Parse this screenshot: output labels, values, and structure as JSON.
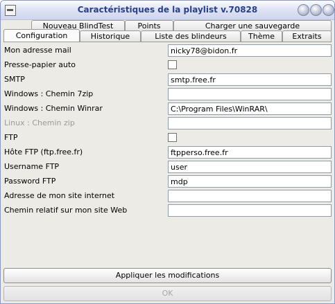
{
  "window": {
    "title": "Caractéristiques de la playlist v.70828"
  },
  "tabs_back": [
    {
      "label": "Nouveau BlindTest"
    },
    {
      "label": "Points"
    },
    {
      "label": "Charger une sauvegarde"
    }
  ],
  "tabs_front": [
    {
      "label": "Configuration",
      "active": true
    },
    {
      "label": "Historique"
    },
    {
      "label": "Liste des blindeurs"
    },
    {
      "label": "Thème"
    },
    {
      "label": "Extraits"
    }
  ],
  "form": {
    "rows": [
      {
        "label": "Mon adresse mail",
        "type": "text",
        "value": "nicky78@bidon.fr"
      },
      {
        "label": "Presse-papier auto",
        "type": "checkbox",
        "checked": false
      },
      {
        "label": "SMTP",
        "type": "text",
        "value": "smtp.free.fr"
      },
      {
        "label": "Windows : Chemin 7zip",
        "type": "text",
        "value": ""
      },
      {
        "label": "Windows : Chemin Winrar",
        "type": "text",
        "value": "C:\\Program Files\\WinRAR\\"
      },
      {
        "label": "Linux : Chemin zip",
        "type": "text",
        "value": "",
        "disabled": true
      },
      {
        "label": "FTP",
        "type": "checkbox",
        "checked": false
      },
      {
        "label": "Hôte FTP (ftp.free.fr)",
        "type": "text",
        "value": "ftpperso.free.fr"
      },
      {
        "label": "Username FTP",
        "type": "text",
        "value": "user"
      },
      {
        "label": "Password FTP",
        "type": "text",
        "value": "mdp"
      },
      {
        "label": "Adresse de mon site internet",
        "type": "text",
        "value": ""
      },
      {
        "label": "Chemin relatif sur mon site Web",
        "type": "text",
        "value": ""
      }
    ]
  },
  "buttons": {
    "apply_label": "Appliquer les modifications",
    "ok_label": "OK"
  }
}
